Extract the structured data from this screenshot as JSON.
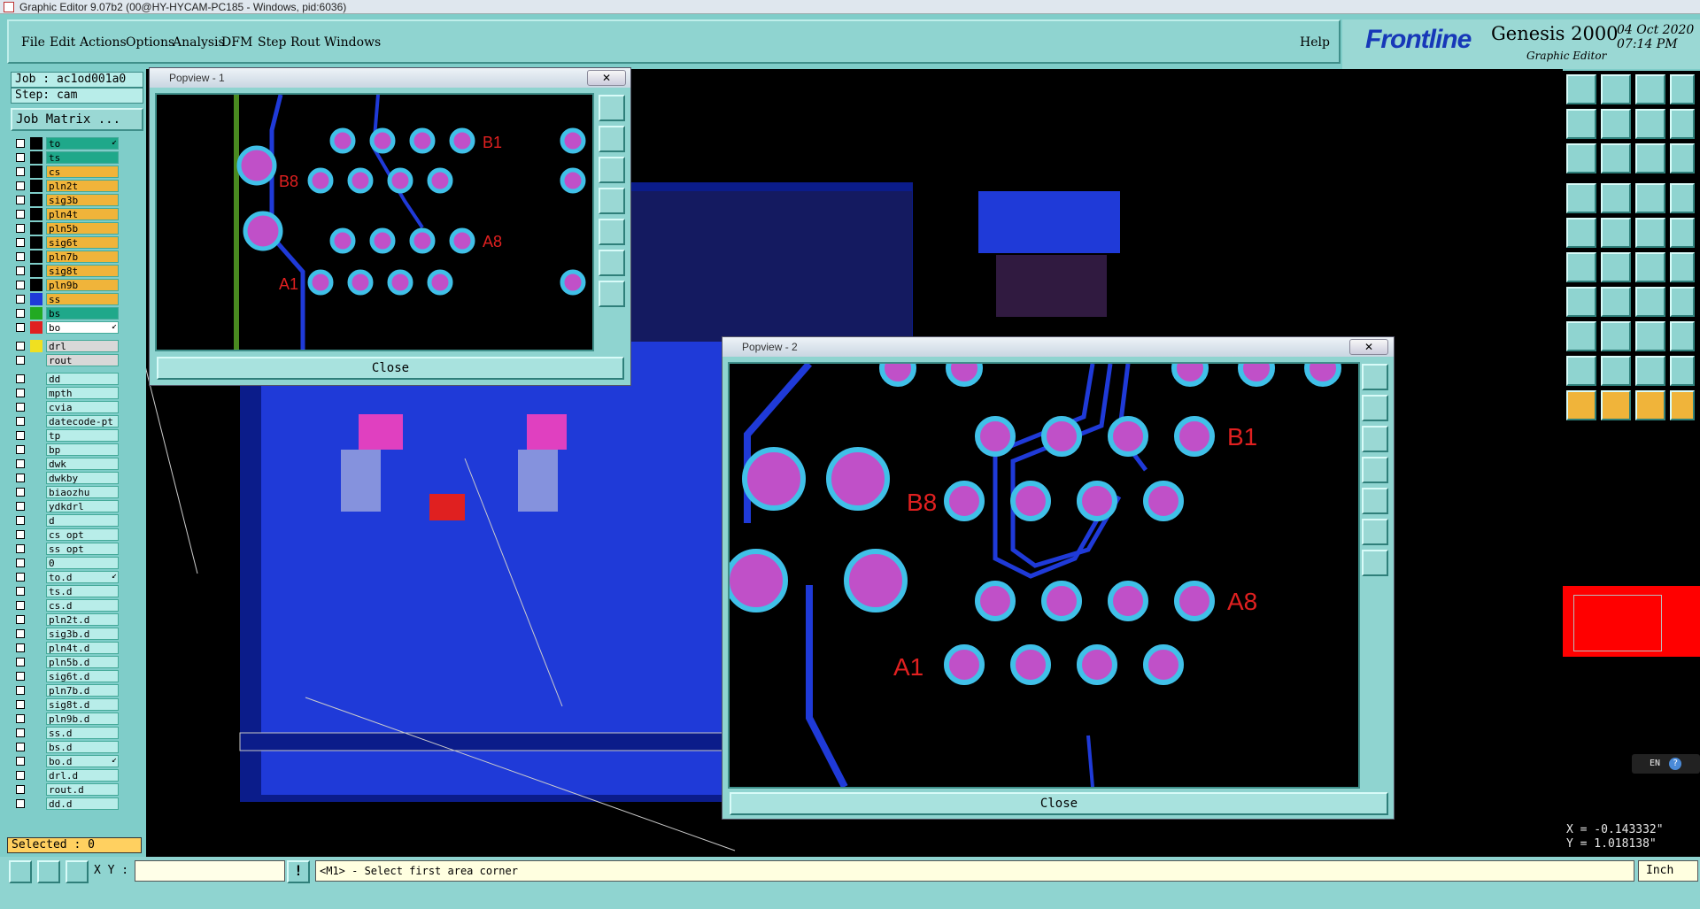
{
  "window": {
    "title": "Graphic Editor 9.07b2 (00@HY-HYCAM-PC185 - Windows, pid:6036)"
  },
  "menu": {
    "items": [
      "File",
      "Edit",
      "Actions",
      "Options",
      "Analysis",
      "DFM",
      "Step",
      "Rout",
      "Windows"
    ],
    "help": "Help"
  },
  "logo": {
    "brand": "Frontline",
    "product": "Genesis 2000",
    "subtitle": "Graphic Editor",
    "date": "04 Oct 2020",
    "time": "07:14 PM"
  },
  "job": {
    "job_label": "Job : ac1od001a0",
    "step_label": "Step: cam",
    "matrix_button": "Job Matrix ..."
  },
  "layers": [
    {
      "name": "to",
      "color": "#1fa88a",
      "swatch": "#000",
      "arrow": true
    },
    {
      "name": "ts",
      "color": "#1fa88a",
      "swatch": "#000"
    },
    {
      "name": "cs",
      "color": "#f0b43a",
      "swatch": "#000"
    },
    {
      "name": "pln2t",
      "color": "#f0b43a",
      "swatch": "#000"
    },
    {
      "name": "sig3b",
      "color": "#f0b43a",
      "swatch": "#000"
    },
    {
      "name": "pln4t",
      "color": "#f0b43a",
      "swatch": "#000"
    },
    {
      "name": "pln5b",
      "color": "#f0b43a",
      "swatch": "#000"
    },
    {
      "name": "sig6t",
      "color": "#f0b43a",
      "swatch": "#000"
    },
    {
      "name": "pln7b",
      "color": "#f0b43a",
      "swatch": "#000"
    },
    {
      "name": "sig8t",
      "color": "#f0b43a",
      "swatch": "#000"
    },
    {
      "name": "pln9b",
      "color": "#f0b43a",
      "swatch": "#000"
    },
    {
      "name": "ss",
      "color": "#f0b43a",
      "swatch": "#1f3ad8"
    },
    {
      "name": "bs",
      "color": "#1fa88a",
      "swatch": "#22aa22"
    },
    {
      "name": "bo",
      "color": "#ffffff",
      "swatch": "#e02020",
      "arrow": true
    },
    {
      "name": "drl",
      "color": "#d8d8d8",
      "swatch": "#f0e020",
      "sep": true
    },
    {
      "name": "rout",
      "color": "#d8d8d8",
      "swatch": "#7fcdc9"
    },
    {
      "name": "dd",
      "color": "#b8ede9",
      "swatch": "#7fcdc9",
      "sep": true
    },
    {
      "name": "mpth",
      "color": "#b8ede9",
      "swatch": "#7fcdc9"
    },
    {
      "name": "cvia",
      "color": "#b8ede9",
      "swatch": "#7fcdc9"
    },
    {
      "name": "datecode-pt",
      "color": "#b8ede9",
      "swatch": "#7fcdc9"
    },
    {
      "name": "tp",
      "color": "#b8ede9",
      "swatch": "#7fcdc9"
    },
    {
      "name": "bp",
      "color": "#b8ede9",
      "swatch": "#7fcdc9"
    },
    {
      "name": "dwk",
      "color": "#b8ede9",
      "swatch": "#7fcdc9"
    },
    {
      "name": "dwkby",
      "color": "#b8ede9",
      "swatch": "#7fcdc9"
    },
    {
      "name": "biaozhu",
      "color": "#b8ede9",
      "swatch": "#7fcdc9"
    },
    {
      "name": "ydkdrl",
      "color": "#b8ede9",
      "swatch": "#7fcdc9"
    },
    {
      "name": "d",
      "color": "#b8ede9",
      "swatch": "#7fcdc9"
    },
    {
      "name": "cs_opt",
      "color": "#b8ede9",
      "swatch": "#7fcdc9"
    },
    {
      "name": "ss_opt",
      "color": "#b8ede9",
      "swatch": "#7fcdc9"
    },
    {
      "name": "0",
      "color": "#b8ede9",
      "swatch": "#7fcdc9"
    },
    {
      "name": "to.d",
      "color": "#b8ede9",
      "swatch": "#7fcdc9",
      "arrow": true
    },
    {
      "name": "ts.d",
      "color": "#b8ede9",
      "swatch": "#7fcdc9"
    },
    {
      "name": "cs.d",
      "color": "#b8ede9",
      "swatch": "#7fcdc9"
    },
    {
      "name": "pln2t.d",
      "color": "#b8ede9",
      "swatch": "#7fcdc9"
    },
    {
      "name": "sig3b.d",
      "color": "#b8ede9",
      "swatch": "#7fcdc9"
    },
    {
      "name": "pln4t.d",
      "color": "#b8ede9",
      "swatch": "#7fcdc9"
    },
    {
      "name": "pln5b.d",
      "color": "#b8ede9",
      "swatch": "#7fcdc9"
    },
    {
      "name": "sig6t.d",
      "color": "#b8ede9",
      "swatch": "#7fcdc9"
    },
    {
      "name": "pln7b.d",
      "color": "#b8ede9",
      "swatch": "#7fcdc9"
    },
    {
      "name": "sig8t.d",
      "color": "#b8ede9",
      "swatch": "#7fcdc9"
    },
    {
      "name": "pln9b.d",
      "color": "#b8ede9",
      "swatch": "#7fcdc9"
    },
    {
      "name": "ss.d",
      "color": "#b8ede9",
      "swatch": "#7fcdc9"
    },
    {
      "name": "bs.d",
      "color": "#b8ede9",
      "swatch": "#7fcdc9"
    },
    {
      "name": "bo.d",
      "color": "#b8ede9",
      "swatch": "#7fcdc9",
      "arrow": true
    },
    {
      "name": "drl.d",
      "color": "#b8ede9",
      "swatch": "#7fcdc9"
    },
    {
      "name": "rout.d",
      "color": "#b8ede9",
      "swatch": "#7fcdc9"
    },
    {
      "name": "dd.d",
      "color": "#b8ede9",
      "swatch": "#7fcdc9"
    }
  ],
  "selected": "Selected : 0",
  "popup1": {
    "title": "Popview - 1",
    "close": "Close",
    "labels": {
      "b1": "B1",
      "b8": "B8",
      "a8": "A8",
      "a1": "A1"
    }
  },
  "popup2": {
    "title": "Popview - 2",
    "close": "Close",
    "labels": {
      "b1": "B1",
      "b8": "B8",
      "a8": "A8",
      "a1": "A1"
    }
  },
  "coords": {
    "x": "X = -0.143332\"",
    "y": "Y = 1.018138\""
  },
  "status": {
    "xy_label": "X Y :",
    "xy_value": "",
    "prompt": "<M1> - Select first area corner",
    "units": "Inch"
  },
  "ime": {
    "lang": "EN"
  },
  "colors": {
    "board_blue": "#1f3ad8",
    "pad_magenta": "#c050c8",
    "pad_cyan": "#40c0e8",
    "label_red": "#e02020",
    "panel": "#8fd4d0"
  }
}
